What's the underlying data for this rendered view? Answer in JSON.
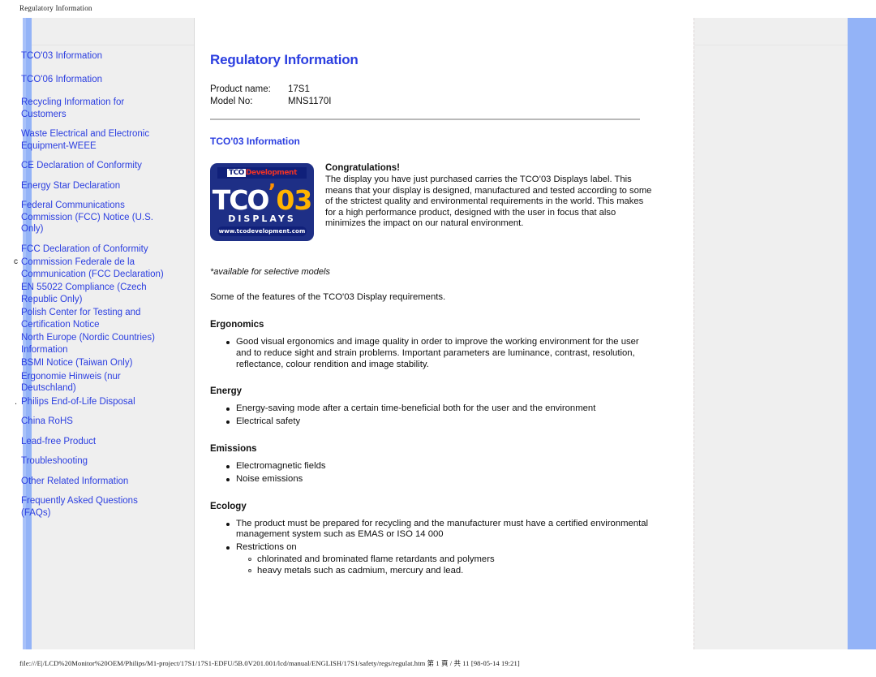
{
  "print_header": "Regulatory Information",
  "sidebar": {
    "items": [
      {
        "label": "TCO'03 Information",
        "marker": "none",
        "spacing": "large"
      },
      {
        "label": "TCO'06 Information",
        "marker": "none",
        "spacing": "large"
      },
      {
        "label": "Recycling Information for Customers",
        "marker": "none",
        "spacing": "normal"
      },
      {
        "label": "Waste Electrical and Electronic Equipment-WEEE",
        "marker": "none",
        "spacing": "normal"
      },
      {
        "label": "CE Declaration of Conformity",
        "marker": "none",
        "spacing": "normal"
      },
      {
        "label": "Energy Star Declaration",
        "marker": "none",
        "spacing": "normal"
      },
      {
        "label": "Federal Communications Commission (FCC) Notice (U.S. Only)",
        "marker": "none",
        "spacing": "normal"
      },
      {
        "label": "FCC Declaration of Conformity",
        "marker": "none",
        "spacing": "tight"
      },
      {
        "label": "Commission Federale de la Communication (FCC Declaration)",
        "marker": "c",
        "spacing": "tight"
      },
      {
        "label": "EN 55022 Compliance (Czech Republic Only)",
        "marker": "none",
        "spacing": "tight"
      },
      {
        "label": "Polish Center for Testing and Certification Notice",
        "marker": "none",
        "spacing": "tight"
      },
      {
        "label": "North Europe (Nordic Countries) Information",
        "marker": "none",
        "spacing": "tight"
      },
      {
        "label": "BSMI Notice (Taiwan Only)",
        "marker": "none",
        "spacing": "tight"
      },
      {
        "label": "Ergonomie Hinweis (nur Deutschland)",
        "marker": "none",
        "spacing": "tight"
      },
      {
        "label": "Philips End-of-Life Disposal",
        "marker": "dot",
        "spacing": "normal"
      },
      {
        "label": "China RoHS",
        "marker": "none",
        "spacing": "normal"
      },
      {
        "label": "Lead-free Product",
        "marker": "none",
        "spacing": "normal"
      },
      {
        "label": "Troubleshooting",
        "marker": "none",
        "spacing": "normal"
      },
      {
        "label": "Other Related Information",
        "marker": "none",
        "spacing": "normal"
      },
      {
        "label": "Frequently Asked Questions (FAQs)",
        "marker": "none",
        "spacing": "normal"
      }
    ]
  },
  "main": {
    "title": "Regulatory Information",
    "product": {
      "name_label": "Product name:",
      "name_value": "17S1",
      "model_label": "Model No:",
      "model_value": "MNS1170I"
    },
    "section_heading": "TCO'03 Information",
    "logo": {
      "top_mark": "TCO",
      "top_word": "Development",
      "word": "TCO",
      "apostrophe": "’",
      "year": "03",
      "subtitle": "DISPLAYS",
      "url": "www.tcodevelopment.com"
    },
    "congratulations": {
      "title": "Congratulations!",
      "body": "The display you have just purchased carries the TCO’03 Displays label. This means that your display is designed, manufactured and tested according to some of the strictest quality and environmental requirements in the world. This makes for a high performance product, designed with the user in focus that also minimizes the impact on our natural environment."
    },
    "note": "*available for selective models",
    "intro": "Some of the features of the TCO'03 Display requirements.",
    "sections": [
      {
        "heading": "Ergonomics",
        "items": [
          "Good visual ergonomics and image quality in order to improve the working environment for the user and to reduce sight and strain problems. Important parameters are luminance, contrast, resolution, reflectance, colour rendition and image stability."
        ]
      },
      {
        "heading": "Energy",
        "items": [
          "Energy-saving mode after a certain time-beneficial both for the user and the environment",
          "Electrical safety"
        ]
      },
      {
        "heading": "Emissions",
        "items": [
          "Electromagnetic fields",
          "Noise emissions"
        ]
      },
      {
        "heading": "Ecology",
        "items": [
          "The product must be prepared for recycling and the manufacturer must have a certified environmental management system such as EMAS or ISO 14 000",
          "Restrictions on"
        ],
        "sub_items": [
          "chlorinated and brominated flame retardants and polymers",
          "heavy metals such as cadmium, mercury and lead."
        ]
      }
    ]
  },
  "footer": "file:///E|/LCD%20Monitor%20OEM/Philips/M1-project/17S1/17S1-EDFU/5B.0V201.001/lcd/manual/ENGLISH/17S1/safety/regs/regulat.htm 第 1 頁 / 共 11 [98-05-14 19:21]",
  "colors": {
    "link": "#2b3ee0",
    "panel": "#efefef",
    "blue_bar": "#93b3f7",
    "logo_blue": "#1e2f86",
    "logo_orange": "#ffb400",
    "logo_red": "#f03226"
  }
}
